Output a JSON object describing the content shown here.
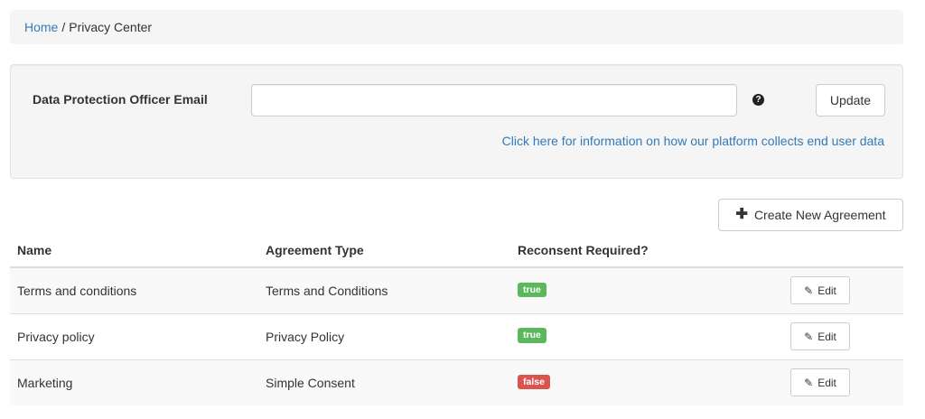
{
  "breadcrumb": {
    "home": "Home",
    "separator": "/",
    "current": "Privacy Center"
  },
  "settings": {
    "dpo_label": "Data Protection Officer Email",
    "dpo_value": "",
    "help_icon": "question-circle-icon",
    "update_label": "Update",
    "info_link": "Click here for information on how our platform collects end user data"
  },
  "create_button": {
    "icon": "plus-icon",
    "label": "Create New Agreement"
  },
  "table": {
    "headers": {
      "name": "Name",
      "type": "Agreement Type",
      "reconsent": "Reconsent Required?"
    },
    "rows": [
      {
        "name": "Terms and conditions",
        "type": "Terms and Conditions",
        "reconsent": "true",
        "edit": "Edit"
      },
      {
        "name": "Privacy policy",
        "type": "Privacy Policy",
        "reconsent": "true",
        "edit": "Edit"
      },
      {
        "name": "Marketing",
        "type": "Simple Consent",
        "reconsent": "false",
        "edit": "Edit"
      }
    ]
  },
  "colors": {
    "link": "#337ab7",
    "badge_true": "#5cb85c",
    "badge_false": "#d9534f",
    "panel_bg": "#f5f5f5"
  }
}
